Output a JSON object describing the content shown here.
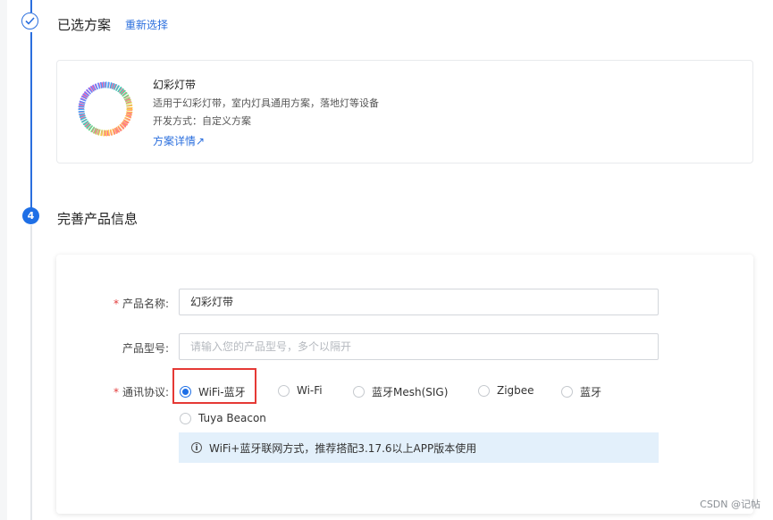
{
  "selected_step": {
    "title": "已选方案",
    "reselect_label": "重新选择"
  },
  "solution": {
    "name": "幻彩灯带",
    "description": "适用于幻彩灯带，室内灯具通用方案，落地灯等设备",
    "dev_mode": "开发方式：自定义方案",
    "details_link": "方案详情↗"
  },
  "info_step": {
    "number": "4",
    "title": "完善产品信息"
  },
  "form": {
    "product_name_label": "产品名称:",
    "product_name_value": "幻彩灯带",
    "product_model_label": "产品型号:",
    "product_model_placeholder": "请输入您的产品型号，多个以隔开",
    "protocol_label": "通讯协议:",
    "required_mark": "*",
    "protocols": [
      {
        "label": "WiFi-蓝牙",
        "checked": true
      },
      {
        "label": "Wi-Fi",
        "checked": false
      },
      {
        "label": "蓝牙Mesh(SIG)",
        "checked": false
      },
      {
        "label": "Zigbee",
        "checked": false
      },
      {
        "label": "蓝牙",
        "checked": false
      },
      {
        "label": "Tuya Beacon",
        "checked": false
      }
    ],
    "info_icon": "info-icon",
    "info_text": "WiFi+蓝牙联网方式，推荐搭配3.17.6以上APP版本使用"
  },
  "watermark": "CSDN @记帖",
  "colors": {
    "accent": "#1e6fe6",
    "link": "#2b6fde",
    "highlight": "#e53935",
    "info_bg": "#e3f0fb",
    "required": "#e23b3b"
  }
}
